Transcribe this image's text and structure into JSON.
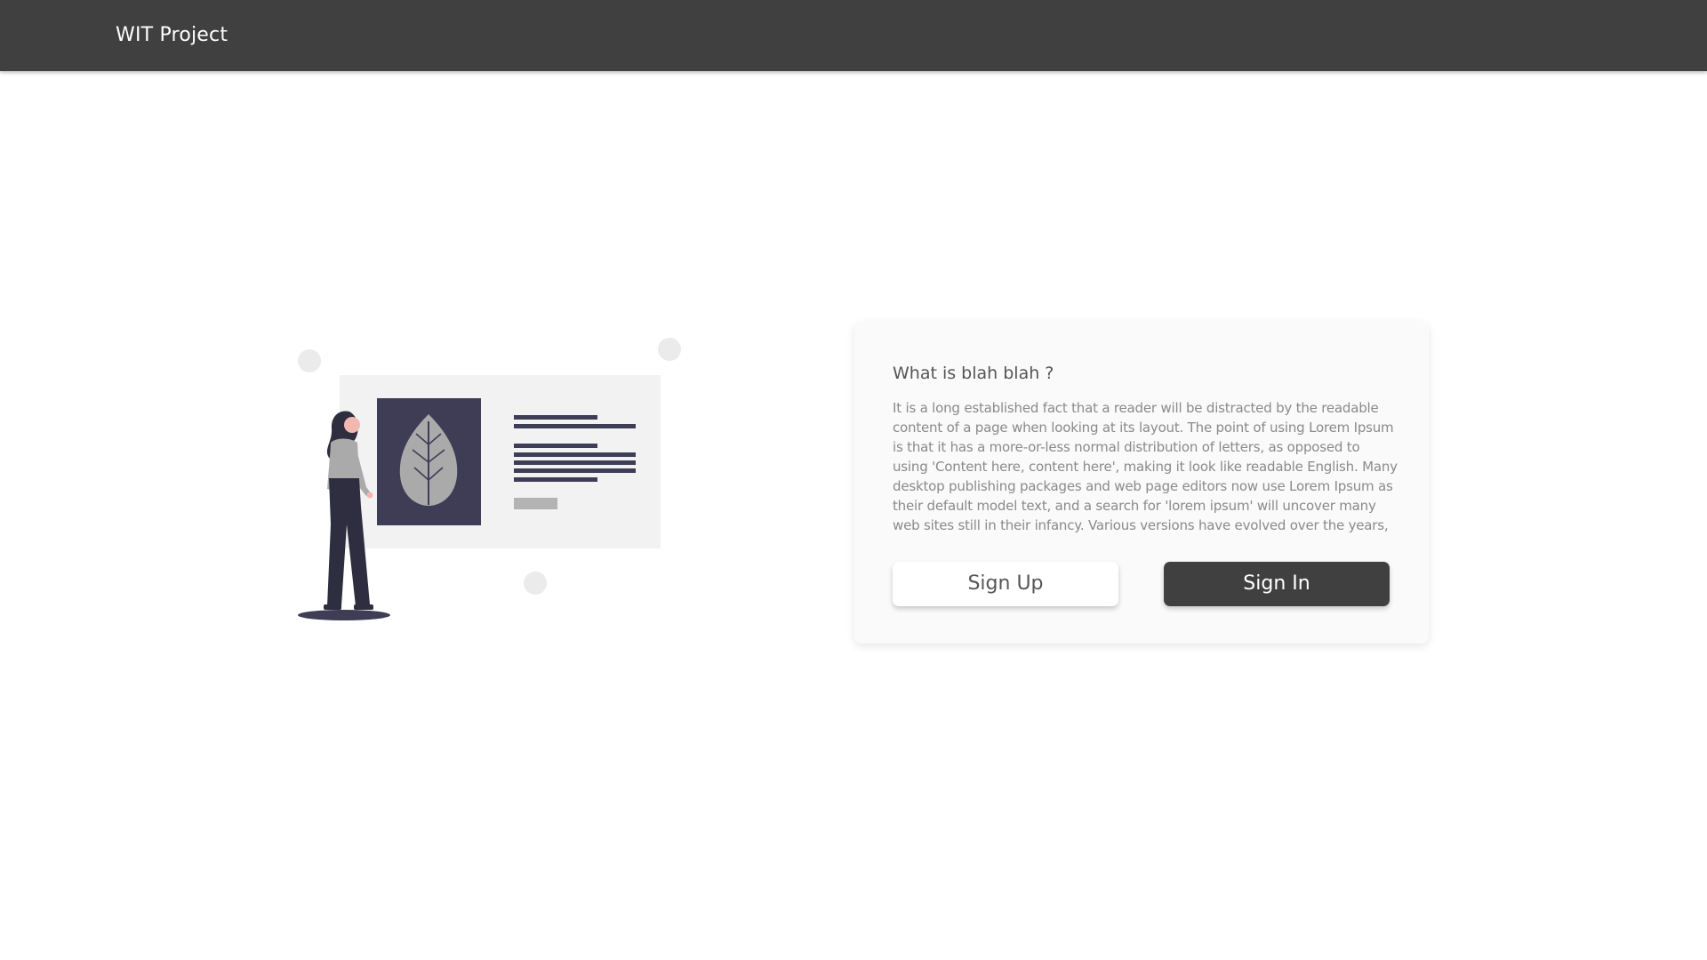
{
  "navbar": {
    "brand": "WIT Project",
    "background": "#404040"
  },
  "illustration": {
    "icon": "woman-presenting-leaf-slide-illustration"
  },
  "card": {
    "title": "What is blah blah ?",
    "text": "It is a long established fact that a reader will be distracted by the readable content of a page when looking at its layout. The point of using Lorem Ipsum is that it has a more-or-less normal distribution of letters, as opposed to using 'Content here, content here', making it look like readable English. Many desktop publishing packages and web page editors now use Lorem Ipsum as their default model text, and a search for 'lorem ipsum' will uncover many web sites still in their infancy. Various versions have evolved over the years,",
    "signup_label": "Sign Up",
    "signin_label": "Sign In"
  }
}
